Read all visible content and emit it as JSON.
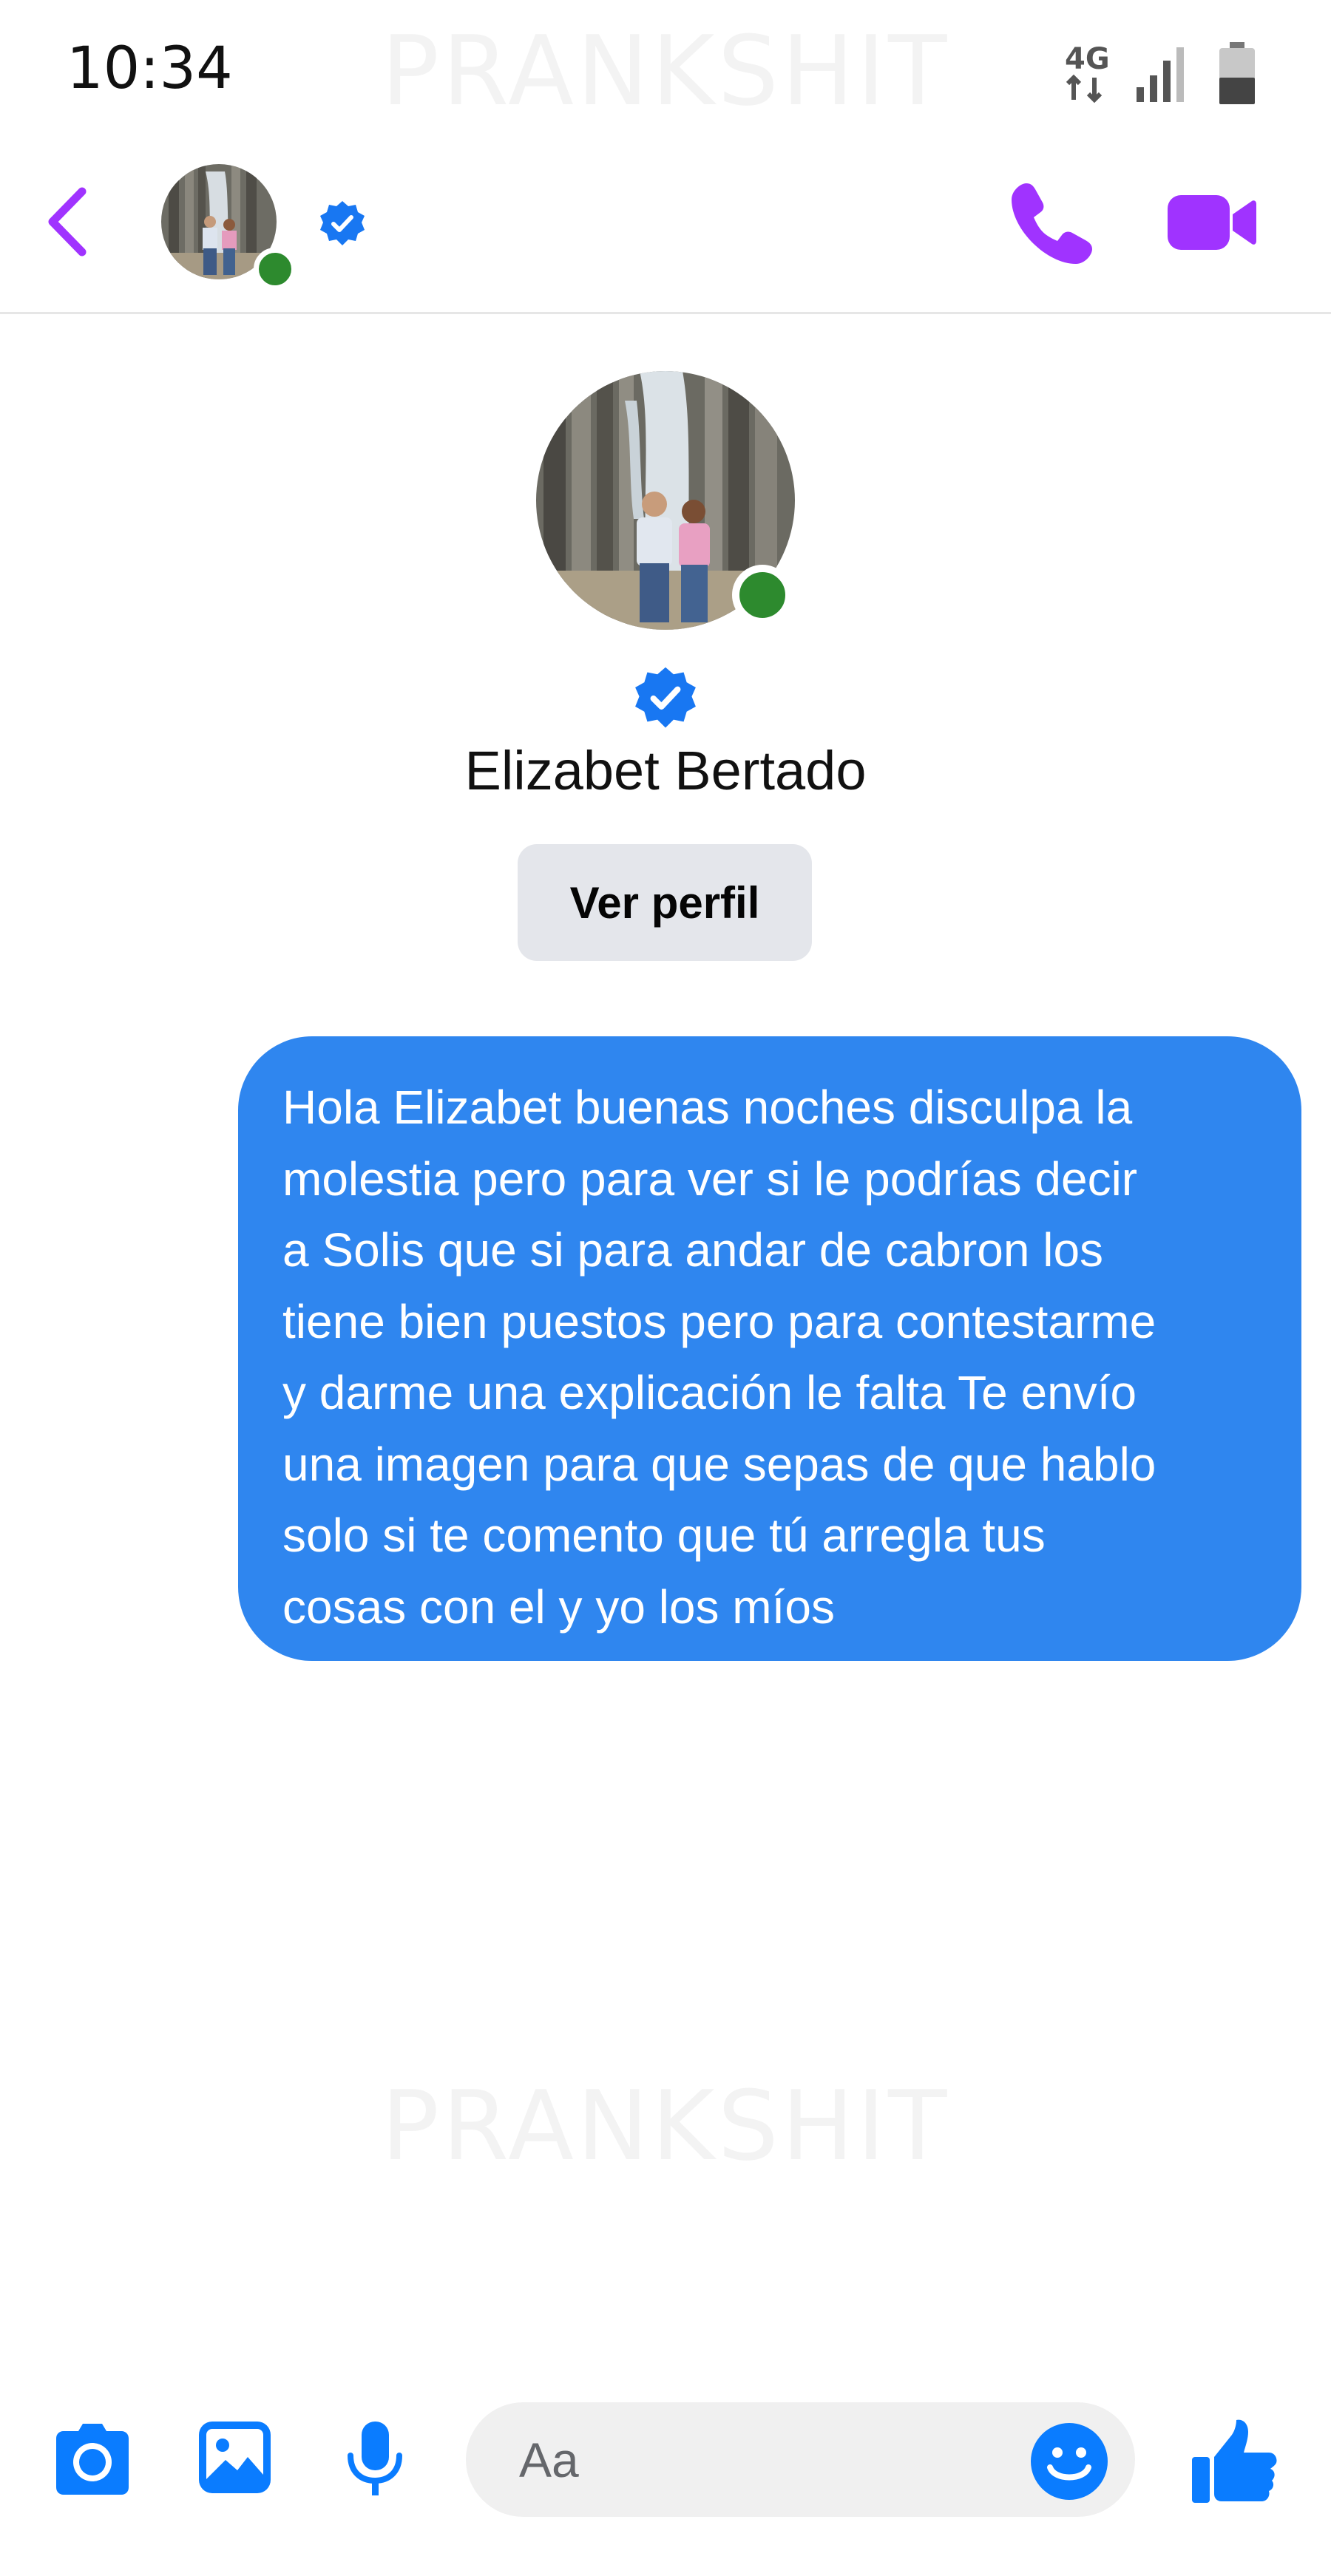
{
  "status_bar": {
    "time": "10:34",
    "network": "4G"
  },
  "watermark": "PRANKSHIT",
  "header": {
    "contact_online": true,
    "verified": true
  },
  "profile": {
    "name": "Elizabet Bertado",
    "view_profile_label": "Ver perfil",
    "online": true,
    "verified": true
  },
  "messages": [
    {
      "direction": "outgoing",
      "lines": [
        "Hola Elizabet buenas noches disculpa la",
        "molestia pero para ver si le podrías decir",
        "a Solis que si para andar de cabron los",
        "tiene bien puestos pero para contestarme",
        "y darme una explicación le falta Te envío",
        "una imagen para que sepas de que hablo",
        "solo si te comento que tú arregla tus",
        "cosas con el y yo los míos"
      ]
    }
  ],
  "composer": {
    "placeholder": "Aa"
  },
  "colors": {
    "accent": "#a033ff",
    "messenger_blue": "#0a7cff",
    "bubble_blue": "#2f86ef",
    "online_green": "#2d8a2e",
    "button_gray": "#e4e6eb"
  },
  "icons": [
    "back-arrow-icon",
    "verified-badge-icon",
    "phone-icon",
    "video-camera-icon",
    "camera-icon",
    "gallery-icon",
    "microphone-icon",
    "emoji-icon",
    "thumbs-up-icon"
  ]
}
